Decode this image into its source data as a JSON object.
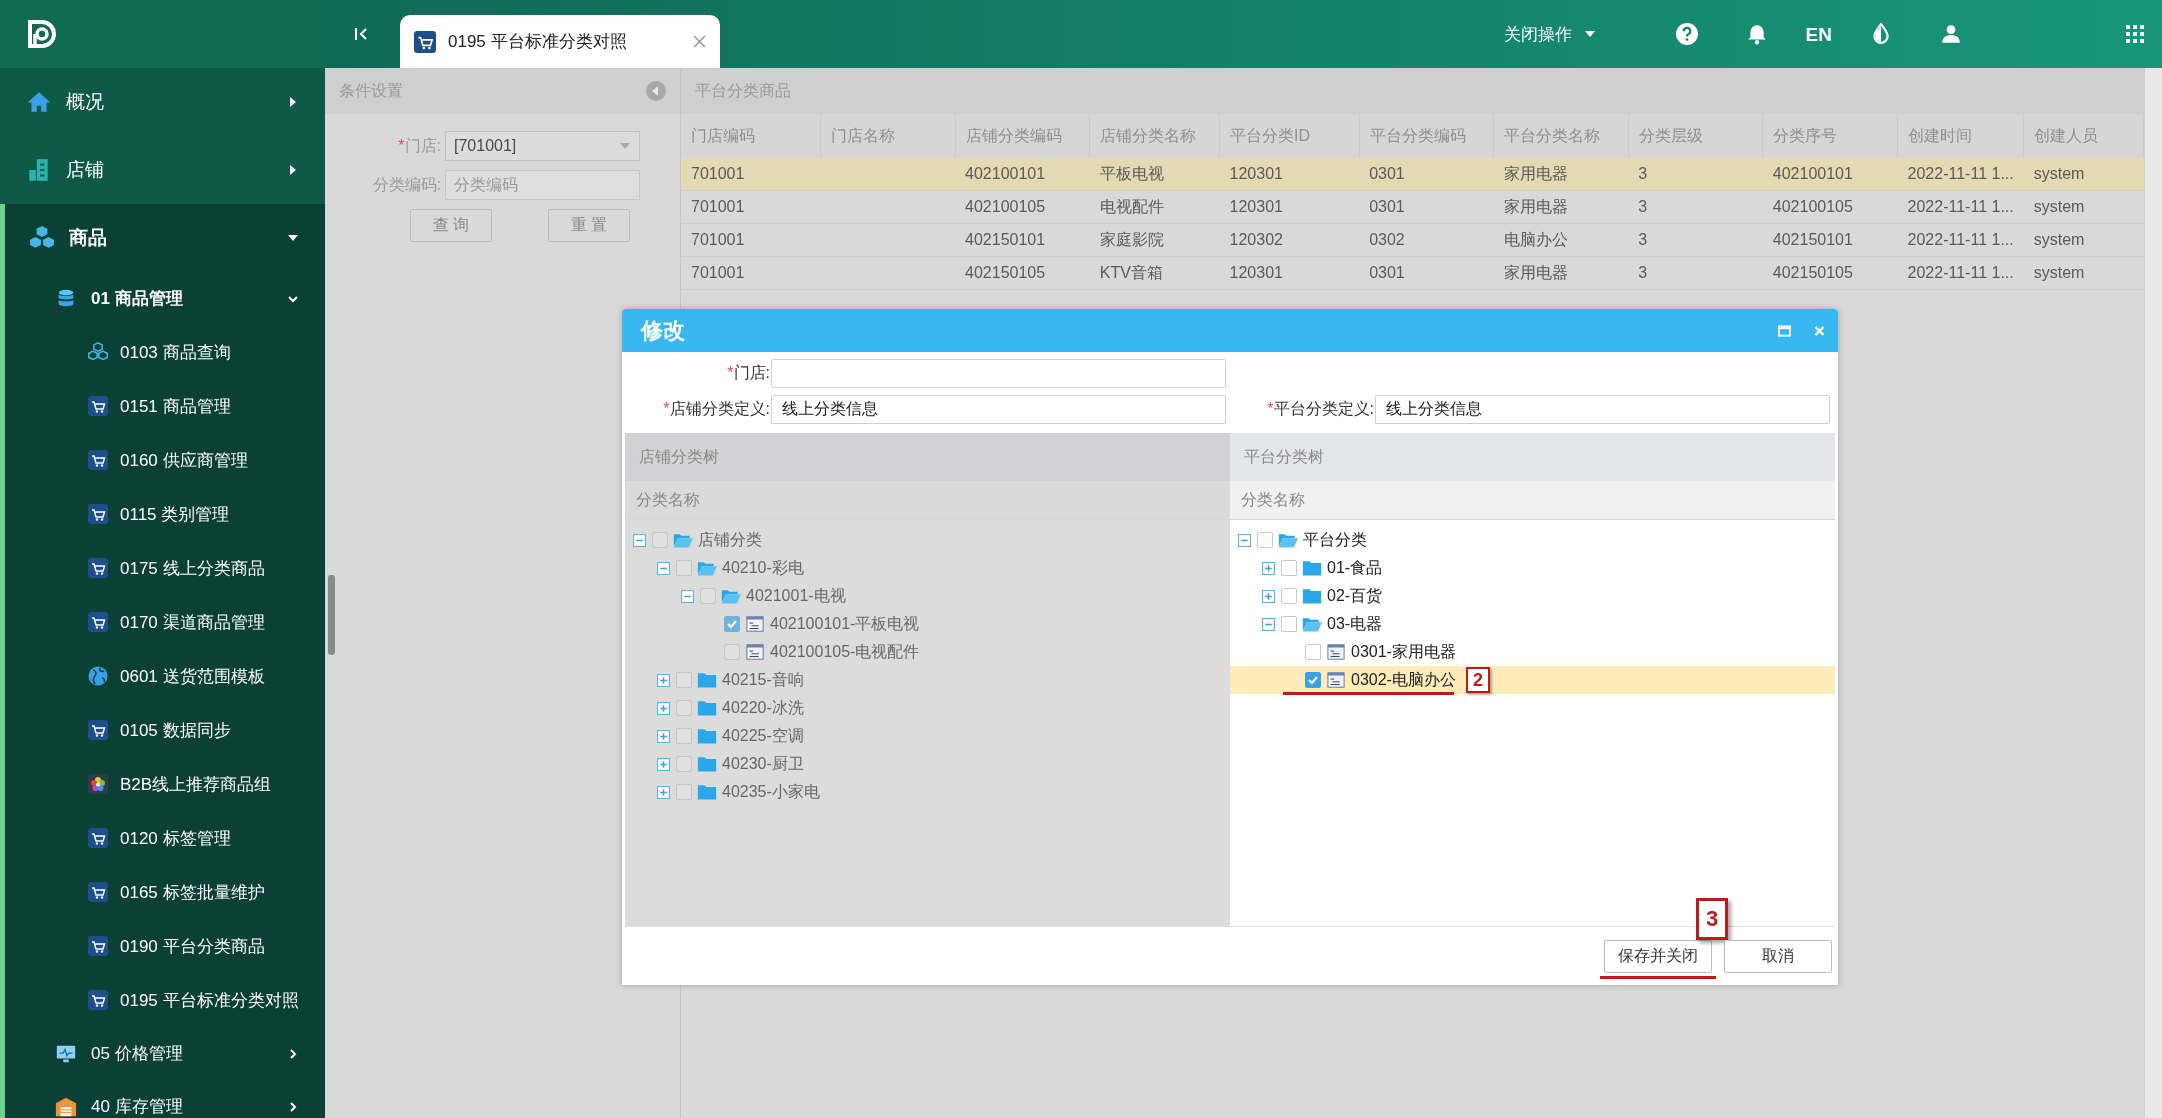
{
  "sidebar": {
    "items": [
      {
        "label": "概况",
        "kind": "house",
        "expanded": false
      },
      {
        "label": "店铺",
        "kind": "building",
        "expanded": false
      },
      {
        "label": "商品",
        "kind": "cubes",
        "expanded": true,
        "children": [
          {
            "label": "01 商品管理",
            "kind": "database",
            "expanded": true,
            "children": [
              {
                "label": "0103 商品查询",
                "kind": "cubes"
              },
              {
                "label": "0151 商品管理",
                "kind": "cart"
              },
              {
                "label": "0160 供应商管理",
                "kind": "cart"
              },
              {
                "label": "0115 类别管理",
                "kind": "cart"
              },
              {
                "label": "0175 线上分类商品",
                "kind": "cart"
              },
              {
                "label": "0170 渠道商品管理",
                "kind": "cart"
              },
              {
                "label": "0601 送货范围模板",
                "kind": "globe"
              },
              {
                "label": "0105 数据同步",
                "kind": "cart"
              },
              {
                "label": "B2B线上推荐商品组",
                "kind": "flower"
              },
              {
                "label": "0120 标签管理",
                "kind": "cart"
              },
              {
                "label": "0165 标签批量维护",
                "kind": "cart"
              },
              {
                "label": "0190 平台分类商品",
                "kind": "cart"
              },
              {
                "label": "0195 平台标准分类对照",
                "kind": "cart"
              }
            ]
          },
          {
            "label": "05 价格管理",
            "kind": "monitor",
            "expanded": false
          },
          {
            "label": "40 库存管理",
            "kind": "warehouse",
            "expanded": false
          }
        ]
      }
    ]
  },
  "topbar": {
    "tab": {
      "label": "0195 平台标准分类对照"
    },
    "close_menu": "关闭操作",
    "language": "EN"
  },
  "filter_panel": {
    "title": "条件设置",
    "fields": [
      {
        "mark": "*",
        "label": "门店:",
        "kind": "select",
        "value": "[701001]"
      },
      {
        "label": "分类编码:",
        "kind": "text",
        "placeholder": "分类编码"
      }
    ],
    "buttons": [
      "查 询",
      "重 置"
    ]
  },
  "table": {
    "title": "平台分类商品",
    "columns": [
      "门店编码",
      "门店名称",
      "店铺分类编码",
      "店铺分类名称",
      "平台分类ID",
      "平台分类编码",
      "平台分类名称",
      "分类层级",
      "分类序号",
      "创建时间",
      "创建人员"
    ],
    "rows": [
      {
        "selected": true,
        "cells": [
          "701001",
          null,
          "402100101",
          "平板电视",
          "120301",
          "0301",
          "家用电器",
          "3",
          "402100101",
          "2022-11-11 1...",
          "system"
        ]
      },
      {
        "selected": false,
        "cells": [
          "701001",
          null,
          "402100105",
          "电视配件",
          "120301",
          "0301",
          "家用电器",
          "3",
          "402100105",
          "2022-11-11 1...",
          "system"
        ]
      },
      {
        "selected": false,
        "cells": [
          "701001",
          null,
          "402150101",
          "家庭影院",
          "120302",
          "0302",
          "电脑办公",
          "3",
          "402150101",
          "2022-11-11 1...",
          "system"
        ]
      },
      {
        "selected": false,
        "cells": [
          "701001",
          null,
          "402150105",
          "KTV音箱",
          "120301",
          "0301",
          "家用电器",
          "3",
          "402150105",
          "2022-11-11 1...",
          "system"
        ]
      }
    ]
  },
  "dialog": {
    "title": "修改",
    "fields": [
      {
        "mark": "*",
        "label": "门店:"
      },
      {
        "mark": "*",
        "label": "店铺分类定义:",
        "value": "线上分类信息"
      },
      {
        "mark": "*",
        "label": "平台分类定义:",
        "value": "线上分类信息"
      }
    ],
    "trees": [
      {
        "title": "店铺分类树",
        "column": "分类名称",
        "disabled": true,
        "nodes": [
          {
            "label": "店铺分类",
            "kind": "folder",
            "expanded": true,
            "checked": false,
            "selected": false,
            "children": [
              {
                "label": "40210-彩电",
                "kind": "folder",
                "expanded": true,
                "checked": false,
                "selected": false,
                "children": [
                  {
                    "label": "4021001-电视",
                    "kind": "folder",
                    "expanded": true,
                    "checked": false,
                    "selected": false,
                    "children": [
                      {
                        "label": "402100101-平板电视",
                        "kind": "leaf",
                        "checked": true,
                        "selected": false
                      },
                      {
                        "label": "402100105-电视配件",
                        "kind": "leaf",
                        "checked": false,
                        "selected": false
                      }
                    ]
                  }
                ]
              },
              {
                "label": "40215-音响",
                "kind": "folder",
                "expanded": false,
                "checked": false,
                "selected": false
              },
              {
                "label": "40220-冰洗",
                "kind": "folder",
                "expanded": false,
                "checked": false,
                "selected": false
              },
              {
                "label": "40225-空调",
                "kind": "folder",
                "expanded": false,
                "checked": false,
                "selected": false
              },
              {
                "label": "40230-厨卫",
                "kind": "folder",
                "expanded": false,
                "checked": false,
                "selected": false
              },
              {
                "label": "40235-小家电",
                "kind": "folder",
                "expanded": false,
                "checked": false,
                "selected": false
              }
            ]
          }
        ]
      },
      {
        "title": "平台分类树",
        "column": "分类名称",
        "disabled": false,
        "nodes": [
          {
            "label": "平台分类",
            "kind": "folder",
            "expanded": true,
            "checked": false,
            "selected": false,
            "children": [
              {
                "label": "01-食品",
                "kind": "folder",
                "expanded": false,
                "checked": false,
                "selected": false
              },
              {
                "label": "02-百货",
                "kind": "folder",
                "expanded": false,
                "checked": false,
                "selected": false
              },
              {
                "label": "03-电器",
                "kind": "folder",
                "expanded": true,
                "checked": false,
                "selected": false,
                "children": [
                  {
                    "label": "0301-家用电器",
                    "kind": "leaf",
                    "checked": false,
                    "selected": false
                  },
                  {
                    "label": "0302-电脑办公",
                    "kind": "leaf",
                    "checked": true,
                    "selected": true,
                    "callout": "2"
                  }
                ]
              }
            ]
          }
        ]
      }
    ],
    "buttons": [
      {
        "label": "保存并关闭",
        "callout": "3"
      },
      {
        "label": "取消"
      }
    ]
  }
}
